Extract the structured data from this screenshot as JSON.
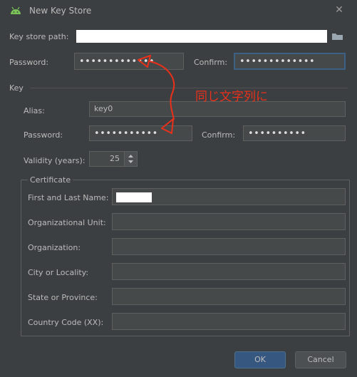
{
  "window": {
    "title": "New Key Store",
    "close_glyph": "✕"
  },
  "keystore": {
    "path_label": "Key store path:",
    "path_value": "",
    "password_label": "Password:",
    "password_value": "•••••••••••••",
    "confirm_label": "Confirm:",
    "confirm_value": "•••••••••••••"
  },
  "key": {
    "section_label": "Key",
    "alias_label": "Alias:",
    "alias_value": "key0",
    "password_label": "Password:",
    "password_value": "•••••••••••",
    "confirm_label": "Confirm:",
    "confirm_value": "••••••••••",
    "validity_label": "Validity (years):",
    "validity_value": "25"
  },
  "certificate": {
    "section_label": "Certificate",
    "fields": [
      {
        "label": "First and Last Name:",
        "value": ""
      },
      {
        "label": "Organizational Unit:",
        "value": ""
      },
      {
        "label": "Organization:",
        "value": ""
      },
      {
        "label": "City or Locality:",
        "value": ""
      },
      {
        "label": "State or Province:",
        "value": ""
      },
      {
        "label": "Country Code (XX):",
        "value": ""
      }
    ]
  },
  "buttons": {
    "ok_label": "OK",
    "cancel_label": "Cancel"
  },
  "annotation": {
    "text": "同じ文字列に",
    "color": "#e8301a"
  },
  "icons": {
    "app": "android-icon",
    "browse": "folder-icon"
  }
}
